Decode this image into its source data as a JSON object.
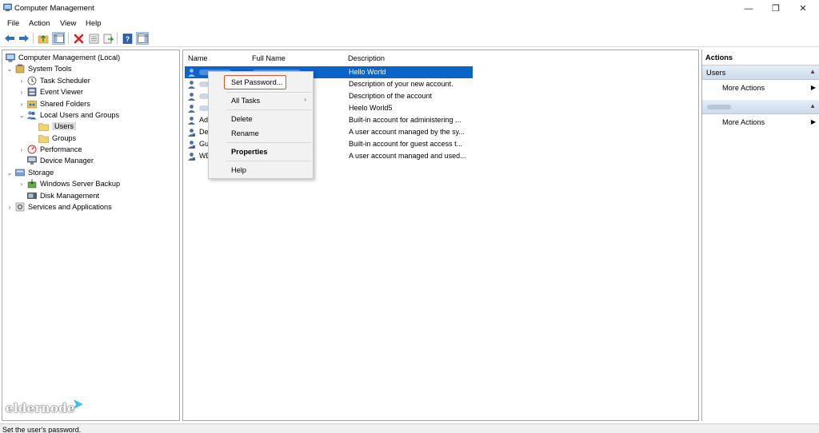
{
  "window": {
    "title": "Computer Management",
    "controls": {
      "minimize": "—",
      "restore": "❐",
      "close": "✕"
    }
  },
  "menu": [
    "File",
    "Action",
    "View",
    "Help"
  ],
  "toolbar_icons": [
    "back-arrow-icon",
    "forward-arrow-icon",
    "up-folder-icon",
    "show-hide-tree-icon",
    "delete-icon",
    "properties-icon",
    "export-list-icon",
    "help-icon",
    "action-pane-icon"
  ],
  "tree": {
    "root": "Computer Management (Local)",
    "system_tools": "System Tools",
    "task_scheduler": "Task Scheduler",
    "event_viewer": "Event Viewer",
    "shared_folders": "Shared Folders",
    "local_users_groups": "Local Users and Groups",
    "users": "Users",
    "groups": "Groups",
    "performance": "Performance",
    "device_manager": "Device Manager",
    "storage": "Storage",
    "windows_server_backup": "Windows Server Backup",
    "disk_management": "Disk Management",
    "services_apps": "Services and Applications"
  },
  "list": {
    "columns": {
      "name": "Name",
      "full_name": "Full Name",
      "description": "Description"
    },
    "rows": [
      {
        "name": "",
        "description": "Hello World",
        "selected": true
      },
      {
        "name": "",
        "description": "Description of your new account."
      },
      {
        "name": "",
        "description": "Description of the account"
      },
      {
        "name": "",
        "description": "Heelo World5"
      },
      {
        "name": "Adr",
        "description": "Built-in account for administering ..."
      },
      {
        "name": "Def",
        "description": "A user account managed by the sy..."
      },
      {
        "name": "Gue",
        "description": "Built-in account for guest access t..."
      },
      {
        "name": "WD",
        "description": "A user account managed and used..."
      }
    ]
  },
  "context_menu": {
    "set_password": "Set Password...",
    "all_tasks": "All Tasks",
    "all_tasks_arrow": "›",
    "delete": "Delete",
    "rename": "Rename",
    "properties": "Properties",
    "help": "Help"
  },
  "actions": {
    "title": "Actions",
    "section1": "Users",
    "more_actions_1": "More Actions",
    "more_actions_2": "More Actions",
    "caret": "▲",
    "arrow": "▶"
  },
  "status": "Set the user's password.",
  "logo": "eldernode",
  "colors": {
    "selection": "#0c64c8",
    "highlight_border": "#d9542e"
  }
}
